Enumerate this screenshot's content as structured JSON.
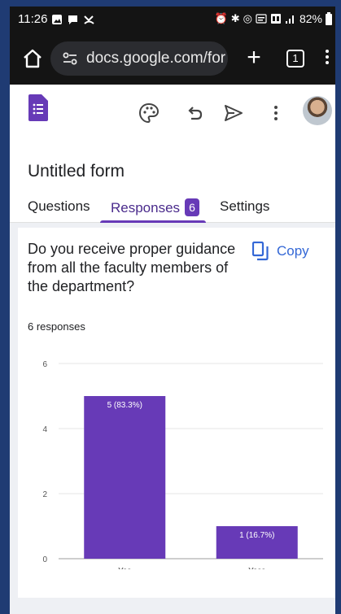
{
  "status_bar": {
    "time": "11:26",
    "battery": "82%",
    "left_icons": [
      "gallery-icon",
      "chat-icon",
      "missed-call-icon"
    ],
    "right_icons": [
      "alarm-icon",
      "bluetooth-icon",
      "hotspot-icon",
      "volte-icon",
      "5g-icon",
      "signal-icon"
    ]
  },
  "browser": {
    "url": "docs.google.com/for",
    "tab_count": "1"
  },
  "form": {
    "title": "Untitled form",
    "tabs": [
      {
        "label": "Questions"
      },
      {
        "label": "Responses",
        "badge": "6"
      },
      {
        "label": "Settings"
      }
    ]
  },
  "question": {
    "text": "Do you receive proper guidance from all the faculty members of the department?",
    "copy_label": "Copy",
    "response_count": "6 responses"
  },
  "colors": {
    "accent": "#673ab7",
    "bar": "#673ab7",
    "link": "#3367d6"
  },
  "chart_data": {
    "type": "bar",
    "categories": [
      "Yes",
      "Yess"
    ],
    "values": [
      5,
      1
    ],
    "data_labels": [
      "5 (83.3%)",
      "1 (16.7%)"
    ],
    "yticks": [
      0,
      2,
      4,
      6
    ],
    "ylim": [
      0,
      6
    ],
    "grid": true
  }
}
